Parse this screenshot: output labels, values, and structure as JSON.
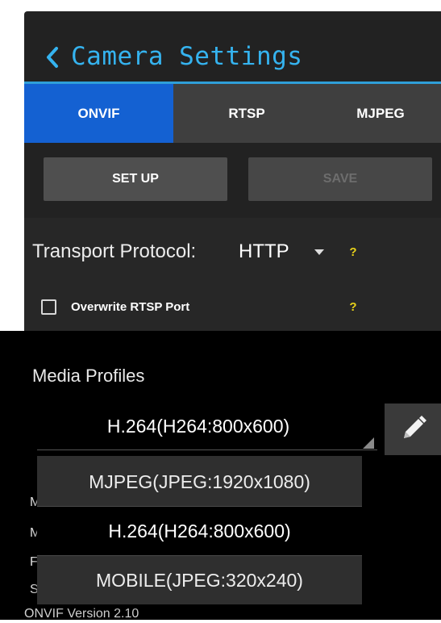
{
  "header": {
    "title": "Camera Settings",
    "back_icon": "chevron-left-icon",
    "accent_color": "#35b3ef"
  },
  "tabs": [
    {
      "label": "ONVIF",
      "selected": true
    },
    {
      "label": "RTSP",
      "selected": false
    },
    {
      "label": "MJPEG",
      "selected": false
    }
  ],
  "actions": {
    "setup_label": "SET UP",
    "save_label": "SAVE",
    "save_enabled": false
  },
  "transport": {
    "label": "Transport Protocol:",
    "value": "HTTP",
    "help": "?"
  },
  "rtsp_port": {
    "label": "Overwrite RTSP Port",
    "checked": false,
    "help": "?"
  },
  "media": {
    "heading": "Media Profiles",
    "selected_profile": "H.264(H264:800x600)",
    "edit_icon": "pencil-icon",
    "options": [
      "MJPEG(JPEG:1920x1080)",
      "H.264(H264:800x600)",
      "MOBILE(JPEG:320x240)"
    ]
  },
  "background": {
    "peek_labels": [
      "M",
      "M",
      "F",
      "S"
    ],
    "onvif_version": "ONVIF Version 2.10"
  },
  "colors": {
    "tab_selected": "#1461d2",
    "help_mark": "#e8d21a"
  }
}
